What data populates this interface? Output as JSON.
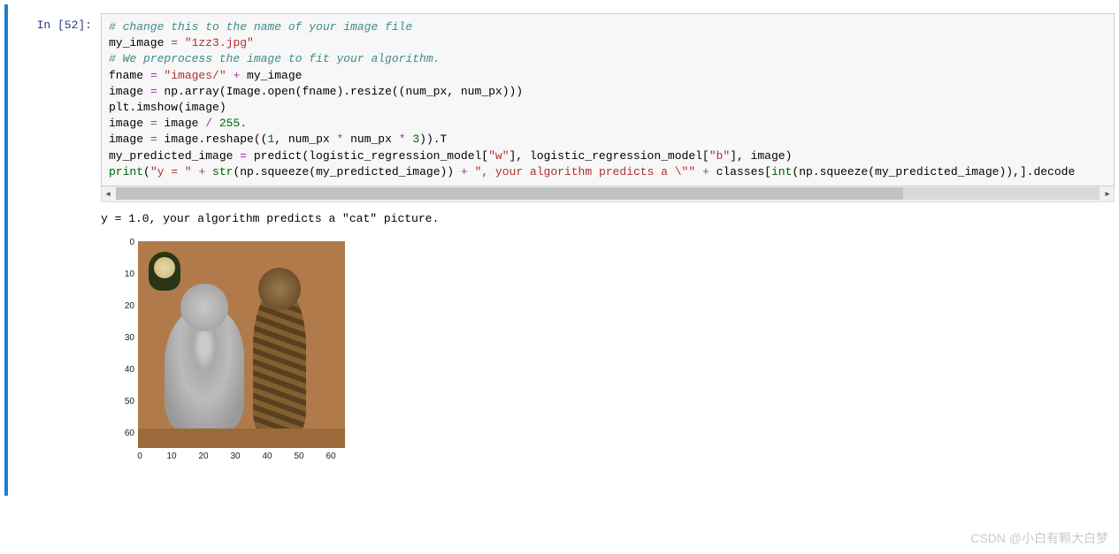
{
  "cell": {
    "prompt_label": "In  [52]:",
    "code": {
      "l1": "# change this to the name of your image file",
      "l2a": "my_image ",
      "l2b": "=",
      "l2c": " \"1zz3.jpg\"",
      "l3": "",
      "l4": "# We preprocess the image to fit your algorithm.",
      "l5a": "fname ",
      "l5b": "=",
      "l5c": " \"images/\"",
      "l5d": " + ",
      "l5e": "my_image",
      "l6a": "image ",
      "l6b": "=",
      "l6c": " np.array(Image.open(fname).resize((num_px, num_px)))",
      "l7": "plt.imshow(image)",
      "l8a": "image ",
      "l8b": "=",
      "l8c": " image ",
      "l8d": "/",
      "l8e": " 255.",
      "l9a": "image ",
      "l9b": "=",
      "l9c": " image.reshape((",
      "l9d": "1",
      "l9e": ", num_px ",
      "l9f": "*",
      "l9g": " num_px ",
      "l9h": "*",
      "l9i": " 3",
      "l9j": ")).T",
      "l10a": "my_predicted_image ",
      "l10b": "=",
      "l10c": " predict(logistic_regression_model[",
      "l10d": "\"w\"",
      "l10e": "], logistic_regression_model[",
      "l10f": "\"b\"",
      "l10g": "], image)",
      "l11": "",
      "l12a": "print",
      "l12b": "(",
      "l12c": "\"y = \"",
      "l12d": " + ",
      "l12e": "str",
      "l12f": "(np.squeeze(my_predicted_image)) ",
      "l12g": "+",
      "l12h": " \", your algorithm predicts a \\\"\"",
      "l12i": " + ",
      "l12j": "classes[",
      "l12k": "int",
      "l12l": "(np.squeeze(my_predicted_image)),].decode"
    }
  },
  "output": {
    "text": "y = 1.0, your algorithm predicts a \"cat\" picture."
  },
  "chart_data": {
    "type": "image",
    "title": "",
    "x_ticks": [
      "0",
      "10",
      "20",
      "30",
      "40",
      "50",
      "60"
    ],
    "y_ticks": [
      "0",
      "10",
      "20",
      "30",
      "40",
      "50",
      "60"
    ],
    "xlim": [
      0,
      64
    ],
    "ylim": [
      64,
      0
    ],
    "description": "RGB image (two cats on brown background) displayed via plt.imshow"
  },
  "watermark": "CSDN @小白有颗大白梦"
}
